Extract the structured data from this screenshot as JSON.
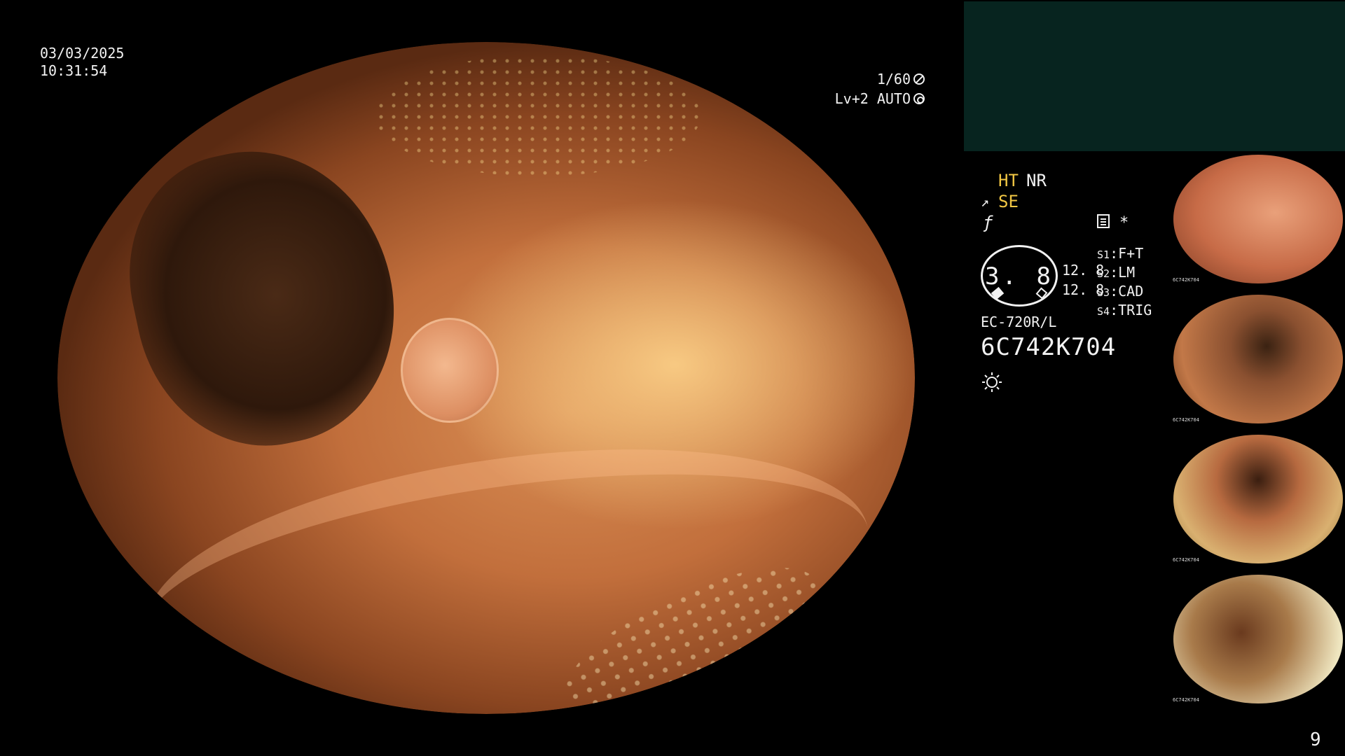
{
  "overlay": {
    "date": "03/03/2025",
    "time": "10:31:54",
    "shutter": "1/60",
    "shutter_icon": "aperture-icon",
    "iris": "Lv+2 AUTO",
    "iris_icon": "iris-ring-icon"
  },
  "status": {
    "ht": "HT",
    "nr": "NR",
    "se": "SE",
    "f_icon": "ƒ",
    "se_icon": "↗"
  },
  "misc": {
    "doc_icon": "document-icon",
    "asterisk": "*"
  },
  "gauge": {
    "value": "3. 8",
    "upper": "12. 8",
    "lower": "12. 8"
  },
  "slots": [
    {
      "key": "S1",
      "value": "F+T"
    },
    {
      "key": "S2",
      "value": "LM"
    },
    {
      "key": "S3",
      "value": "CAD"
    },
    {
      "key": "S4",
      "value": "TRIG"
    }
  ],
  "scope": {
    "model": "EC-720R/L",
    "serial": "6C742K704"
  },
  "thumbnails": [
    {
      "label": "6C742K704"
    },
    {
      "label": "6C742K704"
    },
    {
      "label": "6C742K704"
    },
    {
      "label": "6C742K704"
    }
  ],
  "page_number": "9",
  "colors": {
    "accent_yellow": "#f2c744",
    "panel_teal": "#07241f",
    "text": "#f2f2f2"
  }
}
